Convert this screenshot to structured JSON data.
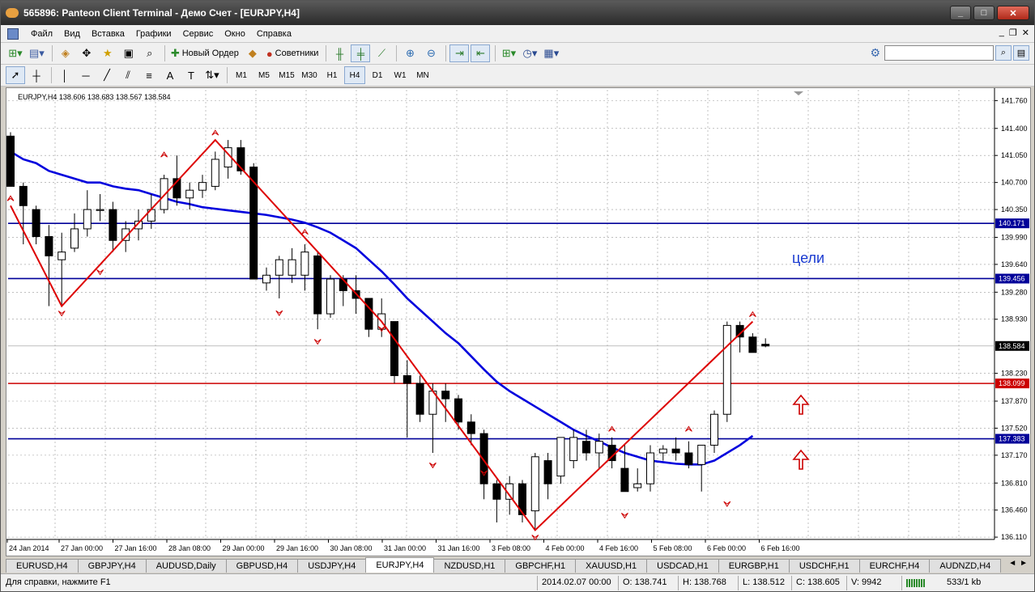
{
  "window": {
    "title": "565896: Panteon Client Terminal - Демо Счет - [EURJPY,H4]",
    "min": "_",
    "max": "□",
    "close": "✕"
  },
  "menu": [
    "Файл",
    "Вид",
    "Вставка",
    "Графики",
    "Сервис",
    "Окно",
    "Справка"
  ],
  "mdi": {
    "min": "_",
    "restore": "❐",
    "close": "✕"
  },
  "toolbar": {
    "new_order": "Новый Ордер",
    "advisors": "Советники",
    "search_placeholder": ""
  },
  "timeframes": [
    "M1",
    "M5",
    "M15",
    "M30",
    "H1",
    "H4",
    "D1",
    "W1",
    "MN"
  ],
  "active_timeframe": "H4",
  "chart": {
    "header": "EURJPY,H4  138.606 138.683 138.567 138.584",
    "annotation": "цели",
    "colors": {
      "bull": "#ffffff",
      "bear": "#000000",
      "ma": "#0000dd",
      "zigzag": "#dd0000",
      "level_blue": "#000099",
      "level_red": "#cc0000",
      "arrow": "#cc0000"
    }
  },
  "chart_data": {
    "type": "candlestick",
    "symbol": "EURJPY",
    "timeframe": "H4",
    "ylim": [
      136.08,
      141.9
    ],
    "price_ticks": [
      "141.760",
      "141.400",
      "141.050",
      "140.700",
      "140.350",
      "139.990",
      "139.640",
      "139.280",
      "138.930",
      "138.230",
      "137.870",
      "137.520",
      "137.170",
      "136.810",
      "136.460",
      "136.110"
    ],
    "time_labels": [
      "24 Jan 2014",
      "27 Jan 00:00",
      "27 Jan 16:00",
      "28 Jan 08:00",
      "29 Jan 00:00",
      "29 Jan 16:00",
      "30 Jan 08:00",
      "31 Jan 00:00",
      "31 Jan 16:00",
      "3 Feb 08:00",
      "4 Feb 00:00",
      "4 Feb 16:00",
      "5 Feb 08:00",
      "6 Feb 00:00",
      "6 Feb 16:00"
    ],
    "price_labels": [
      {
        "value": 140.171,
        "text": "140.171",
        "color": "blue"
      },
      {
        "value": 139.456,
        "text": "139.456",
        "color": "blue"
      },
      {
        "value": 138.584,
        "text": "138.584",
        "color": "black"
      },
      {
        "value": 138.099,
        "text": "138.099",
        "color": "red"
      },
      {
        "value": 137.383,
        "text": "137.383",
        "color": "blue"
      }
    ],
    "levels": [
      {
        "value": 140.171,
        "color": "blue"
      },
      {
        "value": 139.456,
        "color": "blue"
      },
      {
        "value": 138.099,
        "color": "red"
      },
      {
        "value": 137.383,
        "color": "blue"
      }
    ],
    "candles": [
      [
        141.3,
        141.35,
        140.7,
        140.65
      ],
      [
        140.65,
        140.7,
        139.9,
        140.4
      ],
      [
        140.35,
        140.4,
        139.9,
        140.0
      ],
      [
        140.0,
        140.15,
        139.1,
        139.75
      ],
      [
        139.7,
        140.05,
        139.1,
        139.8
      ],
      [
        139.85,
        140.3,
        139.8,
        140.1
      ],
      [
        140.1,
        140.6,
        140.0,
        140.35
      ],
      [
        140.35,
        140.55,
        140.2,
        140.35
      ],
      [
        140.35,
        140.45,
        139.8,
        139.95
      ],
      [
        139.95,
        140.2,
        139.8,
        140.1
      ],
      [
        140.1,
        140.35,
        139.95,
        140.2
      ],
      [
        140.2,
        140.55,
        140.1,
        140.35
      ],
      [
        140.35,
        140.8,
        140.3,
        140.75
      ],
      [
        140.75,
        141.05,
        140.4,
        140.5
      ],
      [
        140.5,
        140.7,
        140.35,
        140.6
      ],
      [
        140.6,
        140.8,
        140.5,
        140.7
      ],
      [
        140.65,
        141.1,
        140.6,
        141.0
      ],
      [
        140.9,
        141.25,
        140.75,
        141.15
      ],
      [
        141.15,
        141.25,
        140.8,
        140.85
      ],
      [
        140.9,
        140.95,
        139.9,
        139.45
      ],
      [
        139.4,
        139.6,
        139.3,
        139.5
      ],
      [
        139.5,
        139.75,
        139.2,
        139.7
      ],
      [
        139.5,
        139.85,
        139.4,
        139.7
      ],
      [
        139.5,
        139.9,
        139.3,
        139.8
      ],
      [
        139.75,
        139.8,
        138.8,
        139.0
      ],
      [
        139.0,
        139.5,
        138.95,
        139.45
      ],
      [
        139.45,
        139.5,
        139.1,
        139.3
      ],
      [
        139.3,
        139.5,
        139.0,
        139.2
      ],
      [
        139.2,
        139.2,
        138.7,
        138.8
      ],
      [
        138.8,
        139.2,
        138.7,
        139.0
      ],
      [
        138.9,
        138.9,
        138.1,
        138.2
      ],
      [
        138.2,
        138.4,
        137.4,
        138.1
      ],
      [
        138.1,
        138.2,
        137.6,
        137.7
      ],
      [
        137.7,
        138.1,
        137.2,
        138.0
      ],
      [
        138.0,
        138.1,
        137.6,
        137.9
      ],
      [
        137.9,
        137.95,
        137.5,
        137.6
      ],
      [
        137.6,
        137.7,
        137.3,
        137.45
      ],
      [
        137.45,
        137.5,
        136.6,
        136.8
      ],
      [
        136.8,
        136.85,
        136.3,
        136.6
      ],
      [
        136.6,
        136.9,
        136.4,
        136.8
      ],
      [
        136.8,
        136.85,
        136.3,
        136.4
      ],
      [
        136.45,
        137.2,
        136.2,
        137.15
      ],
      [
        137.1,
        137.2,
        136.6,
        136.8
      ],
      [
        136.9,
        137.4,
        136.8,
        137.4
      ],
      [
        137.1,
        137.5,
        137.0,
        137.4
      ],
      [
        137.35,
        137.5,
        137.1,
        137.2
      ],
      [
        137.2,
        137.45,
        137.0,
        137.35
      ],
      [
        137.3,
        137.4,
        137.0,
        137.1
      ],
      [
        137.0,
        137.3,
        136.7,
        136.7
      ],
      [
        136.75,
        137.0,
        136.7,
        136.8
      ],
      [
        136.8,
        137.3,
        136.7,
        137.2
      ],
      [
        137.2,
        137.3,
        137.1,
        137.25
      ],
      [
        137.25,
        137.4,
        137.1,
        137.2
      ],
      [
        137.2,
        137.35,
        137.0,
        137.05
      ],
      [
        137.05,
        137.3,
        136.7,
        137.3
      ],
      [
        137.3,
        137.75,
        137.2,
        137.7
      ],
      [
        137.7,
        138.9,
        137.6,
        138.85
      ],
      [
        138.85,
        138.9,
        138.5,
        138.7
      ],
      [
        138.7,
        138.75,
        138.55,
        138.5
      ],
      [
        138.606,
        138.683,
        138.567,
        138.584
      ]
    ],
    "ma": [
      141.1,
      141.0,
      140.95,
      140.85,
      140.8,
      140.75,
      140.7,
      140.7,
      140.65,
      140.62,
      140.6,
      140.55,
      140.5,
      140.45,
      140.42,
      140.38,
      140.36,
      140.34,
      140.32,
      140.3,
      140.28,
      140.25,
      140.22,
      140.18,
      140.12,
      140.05,
      139.95,
      139.85,
      139.7,
      139.55,
      139.38,
      139.2,
      139.05,
      138.9,
      138.75,
      138.62,
      138.45,
      138.28,
      138.12,
      138.0,
      137.9,
      137.8,
      137.7,
      137.6,
      137.5,
      137.42,
      137.35,
      137.27,
      137.2,
      137.15,
      137.1,
      137.08,
      137.06,
      137.05,
      137.05,
      137.1,
      137.2,
      137.3,
      137.42
    ],
    "zigzag": [
      [
        0,
        140.4
      ],
      [
        4,
        139.1
      ],
      [
        16,
        141.25
      ],
      [
        29,
        138.9
      ],
      [
        41,
        136.2
      ],
      [
        58,
        138.9
      ]
    ]
  },
  "tabs": [
    "EURUSD,H4",
    "GBPJPY,H4",
    "AUDUSD,Daily",
    "GBPUSD,H4",
    "USDJPY,H4",
    "EURJPY,H4",
    "NZDUSD,H1",
    "GBPCHF,H1",
    "XAUUSD,H1",
    "USDCAD,H1",
    "EURGBP,H1",
    "USDCHF,H1",
    "EURCHF,H4",
    "AUDNZD,H4"
  ],
  "active_tab": "EURJPY,H4",
  "status": {
    "help": "Для справки, нажмите F1",
    "datetime": "2014.02.07 00:00",
    "open": "O: 138.741",
    "high": "H: 138.768",
    "low": "L: 138.512",
    "close": "C: 138.605",
    "volume": "V: 9942",
    "traffic": "533/1 kb"
  }
}
